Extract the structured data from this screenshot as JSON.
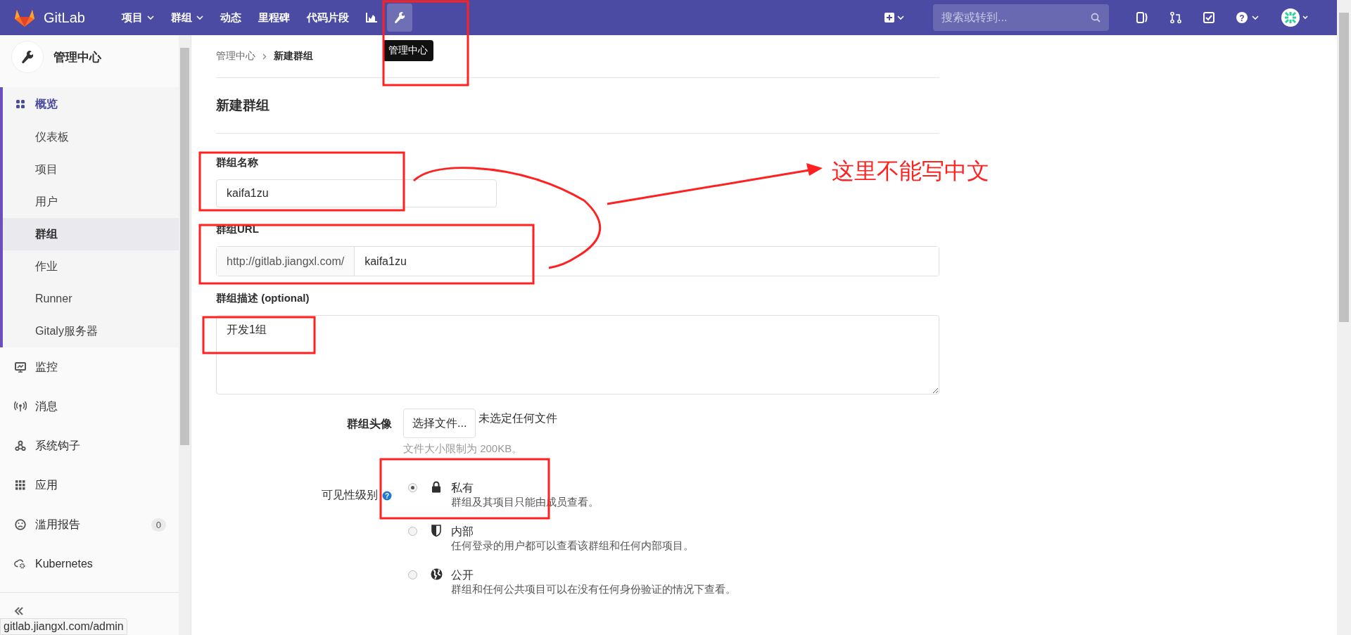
{
  "navbar": {
    "brand": "GitLab",
    "menu": [
      {
        "kind": "text",
        "label": "项目",
        "dropdown": true,
        "selected": false
      },
      {
        "kind": "text",
        "label": "群组",
        "dropdown": true,
        "selected": false
      },
      {
        "kind": "text",
        "label": "动态",
        "dropdown": false,
        "selected": false
      },
      {
        "kind": "text",
        "label": "里程碑",
        "dropdown": false,
        "selected": false
      },
      {
        "kind": "text",
        "label": "代码片段",
        "dropdown": false,
        "selected": false
      },
      {
        "kind": "chart",
        "selected": false
      },
      {
        "kind": "admin",
        "selected": true
      }
    ],
    "tooltip": "管理中心",
    "search": {
      "placeholder": "搜索或转到..."
    },
    "help_glyph": "?"
  },
  "sidebar": {
    "title": "管理中心",
    "sections": [
      {
        "kind": "overview",
        "label": "概览",
        "active": true,
        "children": [
          {
            "label": "仪表板",
            "selected": false
          },
          {
            "label": "项目",
            "selected": false
          },
          {
            "label": "用户",
            "selected": false
          },
          {
            "label": "群组",
            "selected": true
          },
          {
            "label": "作业",
            "selected": false
          },
          {
            "label": "Runner",
            "selected": false
          },
          {
            "label": "Gitaly服务器",
            "selected": false
          }
        ]
      },
      {
        "kind": "monitor",
        "label": "监控",
        "active": false
      },
      {
        "kind": "messages",
        "label": "消息",
        "active": false
      },
      {
        "kind": "hooks",
        "label": "系统钩子",
        "active": false
      },
      {
        "kind": "apps",
        "label": "应用",
        "active": false
      },
      {
        "kind": "abuse",
        "label": "滥用报告",
        "active": false,
        "badge": "0"
      },
      {
        "kind": "kubernetes",
        "label": "Kubernetes",
        "active": false
      }
    ]
  },
  "breadcrumb": [
    "管理中心",
    "新建群组"
  ],
  "page_title": "新建群组",
  "form": {
    "name": {
      "label": "群组名称",
      "value": "kaifa1zu"
    },
    "url": {
      "label": "群组URL",
      "prefix": "http://gitlab.jiangxl.com/",
      "value": "kaifa1zu"
    },
    "description": {
      "label": "**群组描述** (optional)",
      "value": "开发1组"
    },
    "avatar": {
      "label": "群组头像",
      "button": "选择文件...",
      "status": "未选定任何文件",
      "hint": "文件大小限制为 200KB。"
    },
    "visibility": {
      "label": "可见性级别",
      "help_glyph": "?",
      "options": [
        {
          "kind": "private",
          "title": "私有",
          "description": "群组及其项目只能由成员查看。",
          "selected": true
        },
        {
          "kind": "internal",
          "title": "内部",
          "description": "任何登录的用户都可以查看该群组和任何内部项目。",
          "selected": false
        },
        {
          "kind": "public",
          "title": "公开",
          "description": "群组和任何公共项目可以在没有任何身份验证的情况下查看。",
          "selected": false
        }
      ]
    }
  },
  "status_url": "gitlab.jiangxl.com/admin",
  "annotation": {
    "note": "这里不能写中文"
  }
}
